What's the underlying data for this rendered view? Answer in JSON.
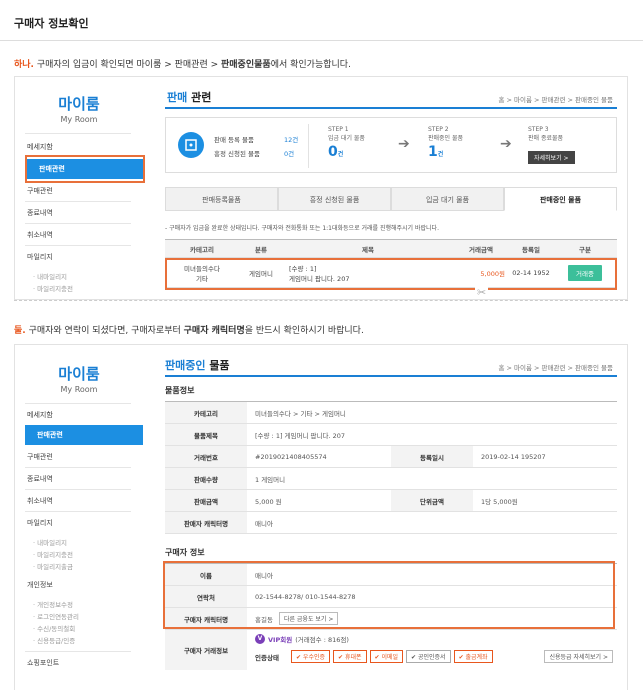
{
  "page_title": "구매자 정보확인",
  "step1": {
    "num": "하나.",
    "text_a": " 구매자의 입금이 확인되면 마이룸 > 판매관련 > ",
    "text_b": "판매중인물품",
    "text_c": "에서 확인가능합니다."
  },
  "step2": {
    "num": "둘.",
    "text_a": " 구매자와 연락이 되셨다면, 구매자로부터 ",
    "text_b": "구매자 캐릭터명",
    "text_c": "을 반드시 확인하시기 바랍니다."
  },
  "logo": {
    "big": "마이룸",
    "small": "My Room"
  },
  "shot1": {
    "menu": [
      "메세지함",
      "판매관련",
      "구매관련",
      "종료내역",
      "취소내역",
      "마일리지"
    ],
    "menu_sub": [
      "· 내마일리지",
      "· 마일리지충전"
    ],
    "title_bold": "판매",
    "title_rest": " 관련",
    "breadcrumb": "홈 > 마이룸 > 판매관련 > 판매중인 물품",
    "status": {
      "line1_label": "판매 등록 물품",
      "line1_val": "12건",
      "line2_label": "흥정 신청된 물품",
      "line2_val": "0건"
    },
    "steps": [
      {
        "head": "STEP 1",
        "label": "입금 대기 물품",
        "count": "0",
        "unit": "건"
      },
      {
        "head": "STEP 2",
        "label": "판매중인 물품",
        "count": "1",
        "unit": "건"
      },
      {
        "head": "STEP 3",
        "label": "판매 종료물품",
        "btn": "자세히보기 >"
      }
    ],
    "tabs": [
      "판매등록물품",
      "흥정 신청된 물품",
      "입금 대기 물품",
      "판매중인 물품"
    ],
    "notice": "- 구매자가 입금을 완료한 상태입니다. 구매자와 전화통화 또는 1:1대화등으로 거래를 진행해주시기 바랍니다.",
    "columns": [
      "카테고리",
      "분류",
      "제목",
      "거래금액",
      "등록일",
      "구분"
    ],
    "row": {
      "category1": "미녀들의수다",
      "category2": "기타",
      "kind": "게임머니",
      "title1": "[수량 : 1]",
      "title2": "게임머니 팝니다. 207",
      "price": "5,000원",
      "date": "02-14 1952",
      "action": "거래중"
    }
  },
  "shot2": {
    "menu": [
      "메세지함",
      "판매관련",
      "구매관련",
      "종료내역",
      "취소내역",
      "마일리지"
    ],
    "menu_sub1": [
      "· 내마일리지",
      "· 마일리지충전",
      "· 마일리지출금"
    ],
    "menu_group": "개인정보",
    "menu_sub2": [
      "· 개인정보수정",
      "· 로그인연동관리",
      "· 수신/동의철회",
      "· 신용등급/인증"
    ],
    "menu_last": "쇼핑포인트",
    "title_blue": "판매중인",
    "title_rest": " 물품",
    "breadcrumb": "홈 > 마이룸 > 판매관련 > 판매중인 물품",
    "goods_head": "물품정보",
    "goods": {
      "category_label": "카테고리",
      "category_val": "미녀들의수다 > 기타 > 게임머니",
      "title_label": "물품제목",
      "title_val": "[수량 : 1] 게임머니 팝니다. 207",
      "trade_no_label": "거래번호",
      "trade_no_val": "#2019021408405574",
      "reg_date_label": "등록일시",
      "reg_date_val": "2019-02-14 195207",
      "qty_label": "판매수량",
      "qty_val": "1 게임머니",
      "amount_label": "판매금액",
      "amount_val": "5,000 원",
      "unit_label": "단위금액",
      "unit_val": "1당 5,000원",
      "seller_label": "판매자 캐릭터명",
      "seller_val": "매니아"
    },
    "buyer_head": "구매자 정보",
    "buyer": {
      "name_label": "이름",
      "name_val": "매니아",
      "contact_label": "연락처",
      "contact_val": "02-1544-8278/ 010-1544-8278",
      "char_label": "구매자 캐릭터명",
      "char_val": "홍길동",
      "char_btn": "다른 금융도 보기 >",
      "deal_label": "구매자 거래정보",
      "vip_badge": "V",
      "vip_text": "VIP회원",
      "vip_score": "(거래점수 : 816점)",
      "auth_label": "인증상태",
      "auth_items": [
        "✔ 우수인증",
        "✔ 휴대폰",
        "✔ 이메일",
        "✔ 공인인증서",
        "✔ 출금계좌"
      ],
      "grade_btn": "신용등급 자세히보기 >"
    }
  },
  "colors": {
    "accent": "#1a7fd4",
    "highlight": "#e8703a",
    "action": "#3cbf9a"
  }
}
